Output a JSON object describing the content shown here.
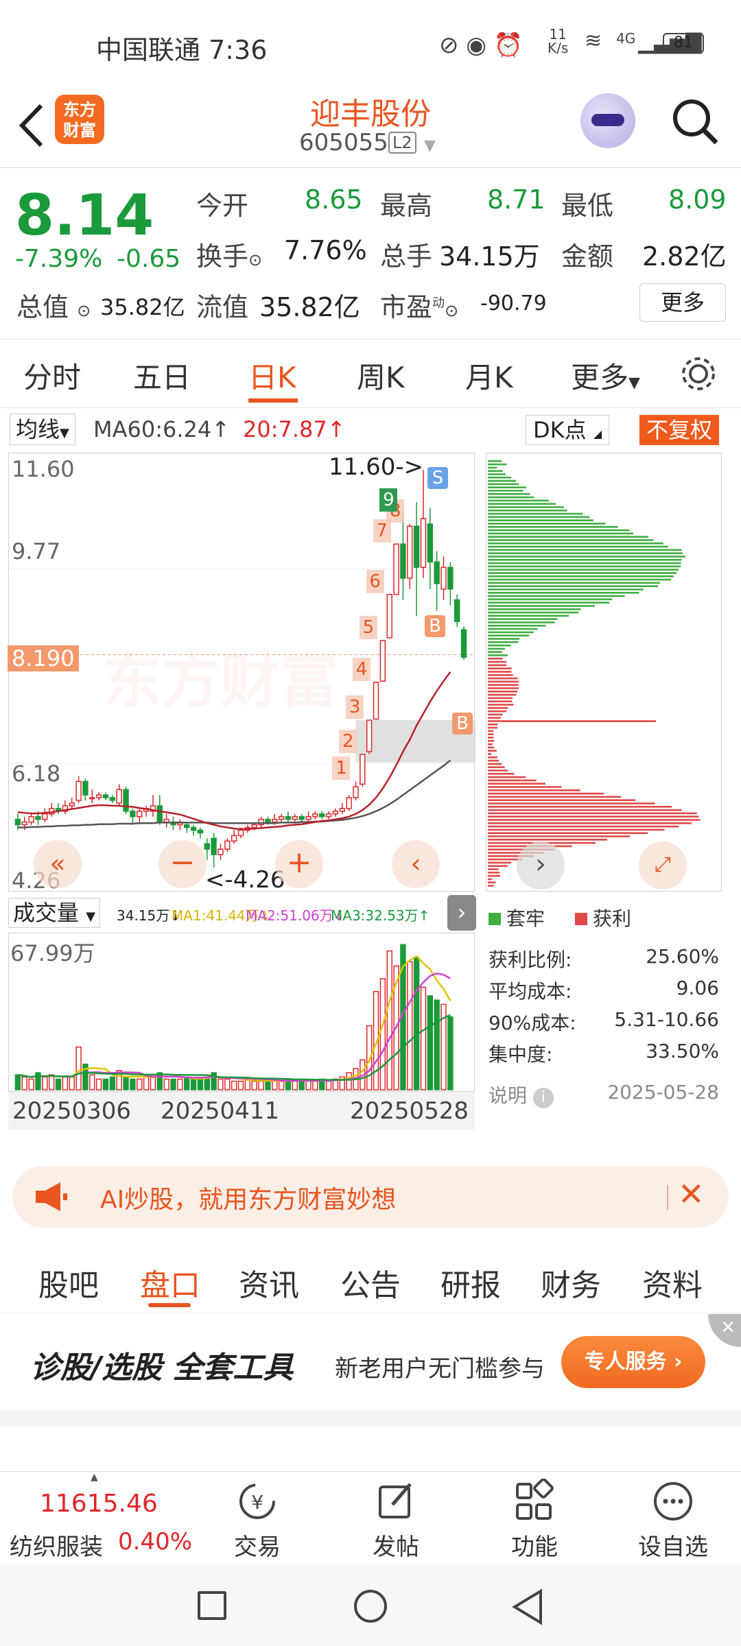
{
  "status_bar": {
    "carrier_time": "中国联通 7:36",
    "net_speed_value": "11",
    "net_speed_unit": "K/s",
    "signal": "4G",
    "battery": "81"
  },
  "header": {
    "logo_line1": "东方",
    "logo_line2": "财富",
    "stock_name": "迎丰股份",
    "stock_code": "605055",
    "level_badge": "L2"
  },
  "quote": {
    "price": "8.14",
    "change_pct": "-7.39%",
    "change": "-0.65",
    "open_label": "今开",
    "open": "8.65",
    "high_label": "最高",
    "high": "8.71",
    "low_label": "最低",
    "low": "8.09",
    "turnover_label": "换手",
    "turnover": "7.76%",
    "volume_label": "总手",
    "volume": "34.15万",
    "amount_label": "金额",
    "amount": "2.82亿",
    "mktcap_label": "总值",
    "mktcap": "35.82亿",
    "float_label": "流值",
    "float_cap": "35.82亿",
    "pe_label": "市盈",
    "pe_sup": "动",
    "pe": "-90.79",
    "more_button": "更多"
  },
  "chart_tabs": [
    "分时",
    "五日",
    "日K",
    "周K",
    "月K",
    "更多"
  ],
  "chart_tabs_active": 2,
  "chart_header": {
    "ma_button": "均线",
    "ma60": "MA60:6.24↑",
    "ma20": "20:7.87↑",
    "dk_button": "DK点",
    "adjust_button": "不复权"
  },
  "kline_labels": {
    "y_top": "11.60",
    "y_mid": "9.77",
    "y_low": "6.18",
    "y_bottom": "4.26",
    "current_price_tag": "8.190",
    "max_annot": "11.60->",
    "min_annot": "<-4.26",
    "watermark": "东方财富"
  },
  "volume_header": {
    "selector": "成交量",
    "vol": "34.15万↓",
    "ma1": "MA1:41.44万↓",
    "ma2": "MA2:51.06万↓",
    "ma3": "MA3:32.53万↑",
    "y_top": "67.99万"
  },
  "date_labels": [
    "20250306",
    "20250411",
    "20250528"
  ],
  "chip": {
    "legend_trapped": "套牢",
    "legend_profit": "获利",
    "rows": [
      {
        "label": "获利比例:",
        "value": "25.60%"
      },
      {
        "label": "平均成本:",
        "value": "9.06"
      },
      {
        "label": "90%成本:",
        "value": "5.31-10.66"
      },
      {
        "label": "集中度:",
        "value": "33.50%"
      }
    ],
    "note_label": "说明",
    "date": "2025-05-28"
  },
  "ai_banner": {
    "text": "AI炒股，就用东方财富妙想"
  },
  "sub_tabs": [
    "股吧",
    "盘口",
    "资讯",
    "公告",
    "研报",
    "财务",
    "资料"
  ],
  "sub_tabs_active": 1,
  "promo": {
    "title": "诊股/选股 全套工具",
    "subtitle": "新老用户无门槛参与",
    "button": "专人服务"
  },
  "bottom_bar": {
    "index_value": "11615.46",
    "index_name": "纺织服装",
    "index_change": "0.40%",
    "items": [
      "交易",
      "发帖",
      "功能",
      "设自选"
    ]
  },
  "chart_data": {
    "type": "bar",
    "title": "",
    "xlabel": "",
    "ylabel": "",
    "candles": [
      {
        "o": 5.15,
        "c": 5.05,
        "h": 5.25,
        "l": 4.95
      },
      {
        "o": 5.05,
        "c": 5.1,
        "h": 5.2,
        "l": 4.95
      },
      {
        "o": 5.1,
        "c": 5.2,
        "h": 5.25,
        "l": 5.05
      },
      {
        "o": 5.2,
        "c": 5.15,
        "h": 5.3,
        "l": 5.05
      },
      {
        "o": 5.15,
        "c": 5.25,
        "h": 5.35,
        "l": 5.1
      },
      {
        "o": 5.25,
        "c": 5.35,
        "h": 5.45,
        "l": 5.2
      },
      {
        "o": 5.35,
        "c": 5.3,
        "h": 5.45,
        "l": 5.25
      },
      {
        "o": 5.3,
        "c": 5.4,
        "h": 5.5,
        "l": 5.25
      },
      {
        "o": 5.4,
        "c": 5.45,
        "h": 5.55,
        "l": 5.35
      },
      {
        "o": 5.5,
        "c": 5.85,
        "h": 5.95,
        "l": 5.45
      },
      {
        "o": 5.85,
        "c": 5.6,
        "h": 5.9,
        "l": 5.5
      },
      {
        "o": 5.55,
        "c": 5.55,
        "h": 5.7,
        "l": 5.45
      },
      {
        "o": 5.55,
        "c": 5.6,
        "h": 5.65,
        "l": 5.5
      },
      {
        "o": 5.6,
        "c": 5.55,
        "h": 5.65,
        "l": 5.5
      },
      {
        "o": 5.55,
        "c": 5.5,
        "h": 5.6,
        "l": 5.45
      },
      {
        "o": 5.45,
        "c": 5.7,
        "h": 5.8,
        "l": 5.4
      },
      {
        "o": 5.7,
        "c": 5.3,
        "h": 5.75,
        "l": 5.25
      },
      {
        "o": 5.3,
        "c": 5.2,
        "h": 5.35,
        "l": 5.05
      },
      {
        "o": 5.2,
        "c": 5.3,
        "h": 5.35,
        "l": 5.1
      },
      {
        "o": 5.3,
        "c": 5.35,
        "h": 5.4,
        "l": 5.2
      },
      {
        "o": 5.3,
        "c": 5.4,
        "h": 5.6,
        "l": 5.2
      },
      {
        "o": 5.4,
        "c": 5.1,
        "h": 5.6,
        "l": 5.05
      },
      {
        "o": 5.1,
        "c": 5.15,
        "h": 5.25,
        "l": 5.0
      },
      {
        "o": 5.1,
        "c": 5.05,
        "h": 5.2,
        "l": 4.95
      },
      {
        "o": 5.05,
        "c": 5.1,
        "h": 5.15,
        "l": 4.95
      },
      {
        "o": 5.05,
        "c": 5.0,
        "h": 5.1,
        "l": 4.9
      },
      {
        "o": 5.0,
        "c": 4.95,
        "h": 5.05,
        "l": 4.85
      },
      {
        "o": 4.95,
        "c": 4.9,
        "h": 5.0,
        "l": 4.8
      },
      {
        "o": 4.7,
        "c": 4.6,
        "h": 4.8,
        "l": 4.4
      },
      {
        "o": 4.8,
        "c": 4.5,
        "h": 4.9,
        "l": 4.26
      },
      {
        "o": 4.5,
        "c": 4.6,
        "h": 4.7,
        "l": 4.4
      },
      {
        "o": 4.6,
        "c": 4.75,
        "h": 4.8,
        "l": 4.55
      },
      {
        "o": 4.75,
        "c": 4.85,
        "h": 4.95,
        "l": 4.7
      },
      {
        "o": 4.85,
        "c": 4.95,
        "h": 5.0,
        "l": 4.8
      },
      {
        "o": 4.95,
        "c": 5.0,
        "h": 5.05,
        "l": 4.9
      },
      {
        "o": 5.0,
        "c": 5.05,
        "h": 5.1,
        "l": 4.95
      },
      {
        "o": 5.05,
        "c": 5.15,
        "h": 5.2,
        "l": 5.0
      },
      {
        "o": 5.15,
        "c": 5.1,
        "h": 5.2,
        "l": 5.05
      },
      {
        "o": 5.1,
        "c": 5.15,
        "h": 5.25,
        "l": 5.05
      },
      {
        "o": 5.15,
        "c": 5.2,
        "h": 5.25,
        "l": 5.1
      },
      {
        "o": 5.2,
        "c": 5.15,
        "h": 5.3,
        "l": 5.1
      },
      {
        "o": 5.15,
        "c": 5.2,
        "h": 5.25,
        "l": 5.1
      },
      {
        "o": 5.2,
        "c": 5.15,
        "h": 5.25,
        "l": 5.1
      },
      {
        "o": 5.15,
        "c": 5.2,
        "h": 5.3,
        "l": 5.1
      },
      {
        "o": 5.2,
        "c": 5.25,
        "h": 5.3,
        "l": 5.15
      },
      {
        "o": 5.25,
        "c": 5.2,
        "h": 5.3,
        "l": 5.15
      },
      {
        "o": 5.2,
        "c": 5.25,
        "h": 5.3,
        "l": 5.15
      },
      {
        "o": 5.25,
        "c": 5.3,
        "h": 5.35,
        "l": 5.2
      },
      {
        "o": 5.3,
        "c": 5.35,
        "h": 5.45,
        "l": 5.25
      },
      {
        "o": 5.35,
        "c": 5.55,
        "h": 5.6,
        "l": 5.3
      },
      {
        "o": 5.55,
        "c": 5.75,
        "h": 5.85,
        "l": 5.5
      },
      {
        "o": 5.8,
        "c": 6.35,
        "h": 6.35,
        "l": 5.75
      },
      {
        "o": 6.4,
        "c": 6.98,
        "h": 6.98,
        "l": 6.35
      },
      {
        "o": 7.0,
        "c": 7.68,
        "h": 7.68,
        "l": 7.0
      },
      {
        "o": 7.7,
        "c": 8.45,
        "h": 8.45,
        "l": 7.7
      },
      {
        "o": 8.5,
        "c": 9.3,
        "h": 9.3,
        "l": 8.5
      },
      {
        "o": 9.3,
        "c": 10.23,
        "h": 10.23,
        "l": 9.3
      },
      {
        "o": 10.23,
        "c": 9.6,
        "h": 10.8,
        "l": 9.2
      },
      {
        "o": 9.6,
        "c": 10.56,
        "h": 10.6,
        "l": 9.4
      },
      {
        "o": 10.56,
        "c": 9.8,
        "h": 11.0,
        "l": 8.9
      },
      {
        "o": 9.8,
        "c": 10.7,
        "h": 11.6,
        "l": 9.6
      },
      {
        "o": 10.6,
        "c": 9.9,
        "h": 10.9,
        "l": 9.4
      },
      {
        "o": 9.9,
        "c": 9.5,
        "h": 10.1,
        "l": 9.0
      },
      {
        "o": 9.4,
        "c": 9.8,
        "h": 10.0,
        "l": 9.2
      },
      {
        "o": 9.8,
        "c": 9.4,
        "h": 9.9,
        "l": 9.1
      },
      {
        "o": 9.2,
        "c": 8.8,
        "h": 9.3,
        "l": 8.7
      },
      {
        "o": 8.65,
        "c": 8.14,
        "h": 8.71,
        "l": 8.09
      }
    ],
    "volumes": [
      7,
      6,
      5,
      8,
      6,
      7,
      5,
      6,
      6,
      20,
      12,
      7,
      5,
      5,
      6,
      9,
      6,
      5,
      5,
      6,
      7,
      8,
      5,
      5,
      5,
      6,
      5,
      5,
      6,
      8,
      5,
      5,
      4,
      4,
      5,
      4,
      4,
      4,
      4,
      4,
      5,
      4,
      5,
      4,
      4,
      5,
      4,
      5,
      6,
      8,
      10,
      14,
      30,
      46,
      52,
      65,
      58,
      67.99,
      60,
      62,
      48,
      44,
      42,
      40,
      34.15
    ],
    "ma20": [
      5.28,
      5.27,
      5.26,
      5.26,
      5.27,
      5.28,
      5.3,
      5.32,
      5.34,
      5.36,
      5.38,
      5.4,
      5.41,
      5.41,
      5.4,
      5.4,
      5.39,
      5.38,
      5.36,
      5.34,
      5.32,
      5.3,
      5.28,
      5.26,
      5.24,
      5.2,
      5.16,
      5.12,
      5.08,
      5.05,
      5.02,
      5.0,
      4.98,
      4.97,
      4.97,
      4.98,
      4.99,
      5.0,
      5.01,
      5.02,
      5.04,
      5.05,
      5.06,
      5.08,
      5.1,
      5.12,
      5.13,
      5.15,
      5.17,
      5.2,
      5.25,
      5.32,
      5.42,
      5.55,
      5.72,
      5.92,
      6.15,
      6.4,
      6.62,
      6.88,
      7.1,
      7.32,
      7.52,
      7.7,
      7.87
    ],
    "ma60": [
      5.0,
      5.0,
      5.01,
      5.01,
      5.02,
      5.02,
      5.03,
      5.03,
      5.04,
      5.04,
      5.05,
      5.05,
      5.06,
      5.06,
      5.06,
      5.07,
      5.07,
      5.07,
      5.08,
      5.08,
      5.08,
      5.09,
      5.09,
      5.09,
      5.09,
      5.09,
      5.09,
      5.09,
      5.09,
      5.08,
      5.08,
      5.08,
      5.08,
      5.08,
      5.08,
      5.08,
      5.08,
      5.08,
      5.08,
      5.09,
      5.09,
      5.09,
      5.1,
      5.1,
      5.11,
      5.11,
      5.12,
      5.13,
      5.14,
      5.16,
      5.18,
      5.21,
      5.25,
      5.3,
      5.36,
      5.43,
      5.51,
      5.6,
      5.69,
      5.78,
      5.87,
      5.96,
      6.05,
      6.14,
      6.24
    ],
    "ylim": [
      4.26,
      11.6
    ],
    "markers": [
      {
        "label": "1",
        "i": 50
      },
      {
        "label": "2",
        "i": 51
      },
      {
        "label": "3",
        "i": 52
      },
      {
        "label": "4",
        "i": 53
      },
      {
        "label": "5",
        "i": 54
      },
      {
        "label": "6",
        "i": 55
      },
      {
        "label": "7",
        "i": 56
      },
      {
        "label": "8",
        "i": 58
      },
      {
        "label": "9",
        "i": 57
      }
    ]
  }
}
